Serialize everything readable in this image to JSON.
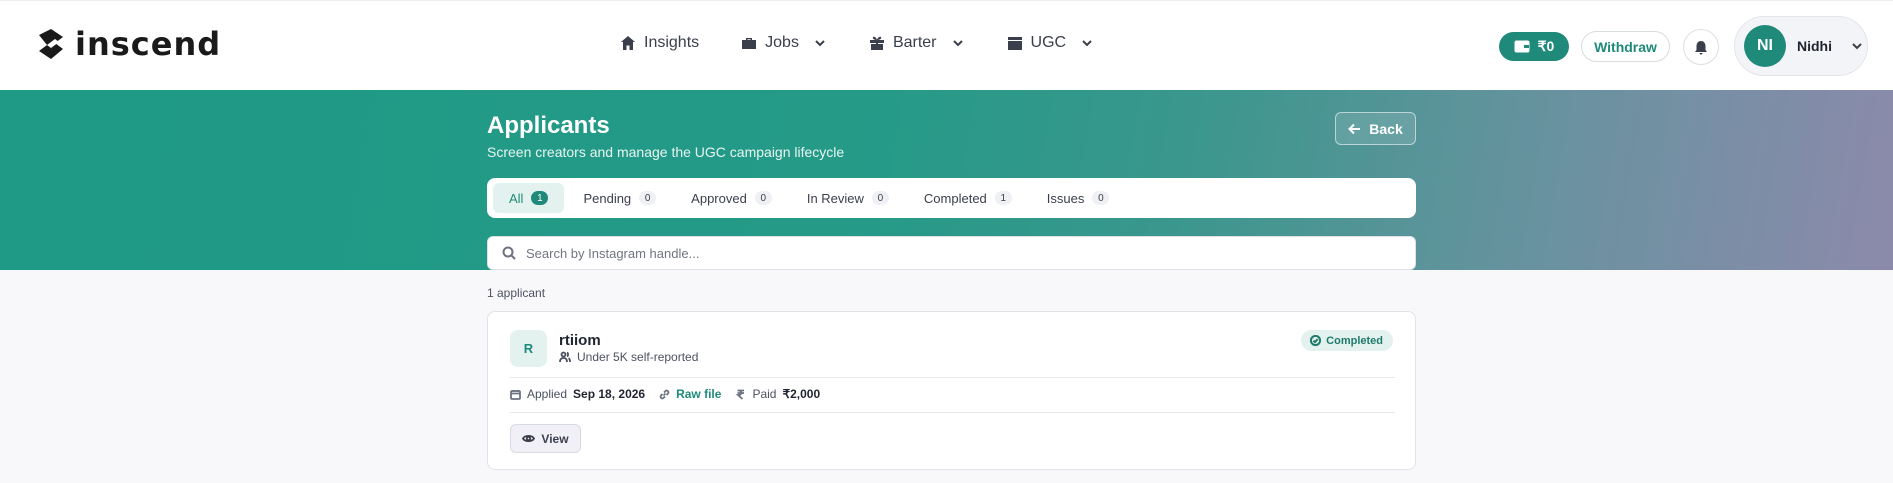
{
  "brand": {
    "name": "inscend"
  },
  "nav": [
    {
      "label": "Insights",
      "icon": "home-icon",
      "dropdown": false
    },
    {
      "label": "Jobs",
      "icon": "briefcase-icon",
      "dropdown": true
    },
    {
      "label": "Barter",
      "icon": "gift-icon",
      "dropdown": true
    },
    {
      "label": "UGC",
      "icon": "clapperboard-icon",
      "dropdown": true
    }
  ],
  "header": {
    "wallet_amount": "₹0",
    "withdraw_label": "Withdraw",
    "user_initials": "NI",
    "user_name": "Nidhi"
  },
  "page": {
    "title": "Applicants",
    "subtitle": "Screen creators and manage the UGC campaign lifecycle",
    "back_label": "Back"
  },
  "tabs": [
    {
      "label": "All",
      "count": "1",
      "active": true
    },
    {
      "label": "Pending",
      "count": "0",
      "active": false
    },
    {
      "label": "Approved",
      "count": "0",
      "active": false
    },
    {
      "label": "In Review",
      "count": "0",
      "active": false
    },
    {
      "label": "Completed",
      "count": "1",
      "active": false
    },
    {
      "label": "Issues",
      "count": "0",
      "active": false
    }
  ],
  "search": {
    "placeholder": "Search by Instagram handle...",
    "value": ""
  },
  "results": {
    "count_text": "1 applicant"
  },
  "applicant": {
    "initial": "R",
    "handle": "rtiiom",
    "followers": "Under 5K self-reported",
    "status": "Completed",
    "applied_label": "Applied",
    "applied_date": "Sep 18, 2026",
    "raw_file_label": "Raw file",
    "paid_label": "Paid",
    "paid_amount": "₹2,000",
    "view_label": "View"
  },
  "colors": {
    "accent": "#1f8a7a",
    "hero_start": "#1e9a86",
    "hero_end": "#8c8aab",
    "badge_bg": "#e3f2ef"
  }
}
